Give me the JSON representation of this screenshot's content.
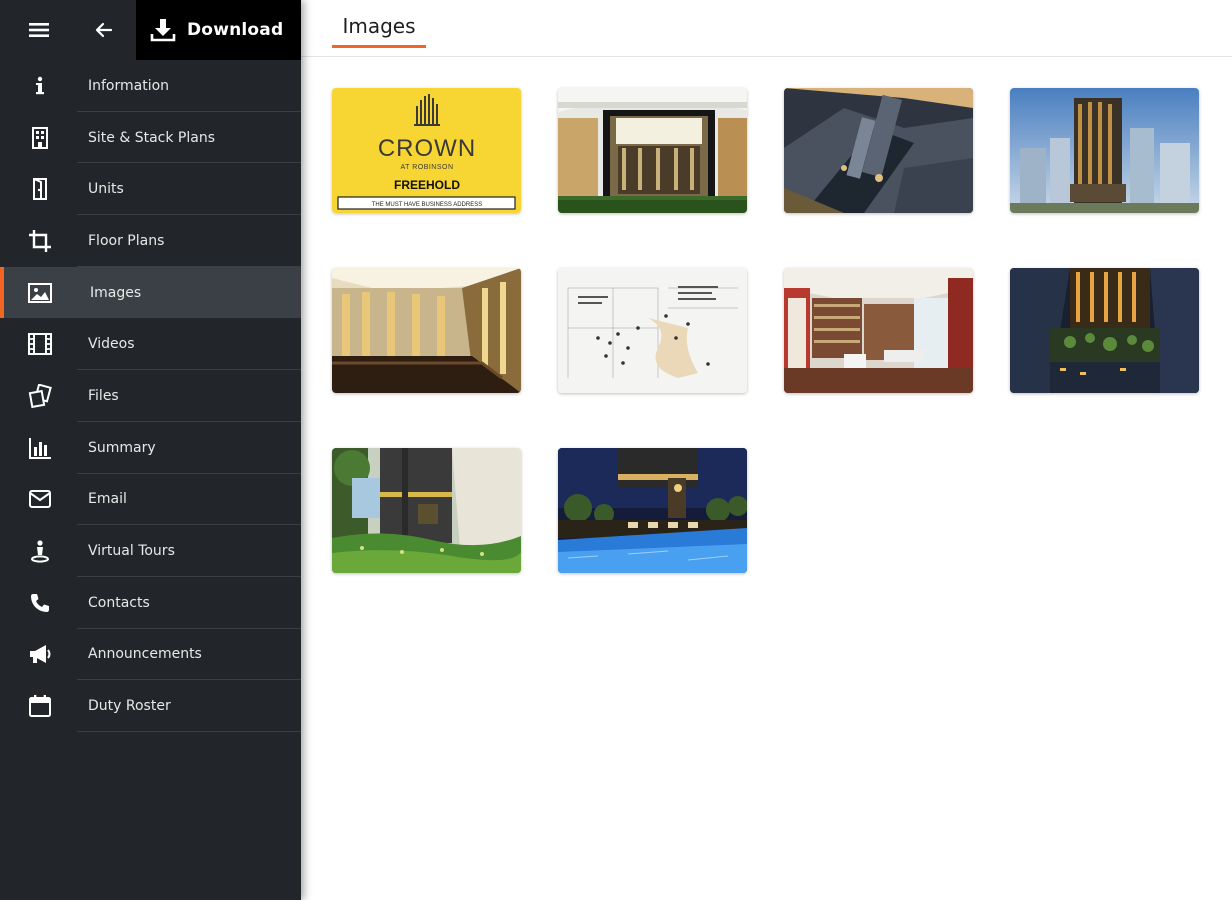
{
  "topbar": {
    "menu_icon": "hamburger-menu-icon",
    "back_icon": "arrow-left-icon",
    "download_icon": "download-icon",
    "download_label": "Download"
  },
  "sidebar": {
    "active_index": 4,
    "items": [
      {
        "label": "Information",
        "icon": "info-icon"
      },
      {
        "label": "Site & Stack Plans",
        "icon": "building-icon"
      },
      {
        "label": "Units",
        "icon": "door-icon"
      },
      {
        "label": "Floor Plans",
        "icon": "crop-icon"
      },
      {
        "label": "Images",
        "icon": "image-icon"
      },
      {
        "label": "Videos",
        "icon": "film-icon"
      },
      {
        "label": "Files",
        "icon": "files-icon"
      },
      {
        "label": "Summary",
        "icon": "bar-chart-icon"
      },
      {
        "label": "Email",
        "icon": "envelope-icon"
      },
      {
        "label": "Virtual Tours",
        "icon": "person-pin-icon"
      },
      {
        "label": "Contacts",
        "icon": "phone-icon"
      },
      {
        "label": "Announcements",
        "icon": "megaphone-icon"
      },
      {
        "label": "Duty Roster",
        "icon": "calendar-icon"
      }
    ]
  },
  "main": {
    "tab_label": "Images",
    "images": [
      {
        "name": "crown-logo-image",
        "logo": {
          "title": "CROWN",
          "subtitle": "AT ROBINSON",
          "tag": "FREEHOLD",
          "tagline": "THE MUST HAVE BUSINESS ADDRESS"
        }
      },
      {
        "name": "entrance-lobby-image"
      },
      {
        "name": "aerial-view-image"
      },
      {
        "name": "tower-exterior-image"
      },
      {
        "name": "interior-lobby-image"
      },
      {
        "name": "location-map-image"
      },
      {
        "name": "office-interior-image"
      },
      {
        "name": "night-aerial-image"
      },
      {
        "name": "garden-entrance-image"
      },
      {
        "name": "pool-night-image"
      }
    ]
  },
  "colors": {
    "sidebar_bg": "#22262a",
    "active_bg": "#3b4046",
    "accent": "#f26522",
    "logo_yellow": "#f7d533"
  }
}
